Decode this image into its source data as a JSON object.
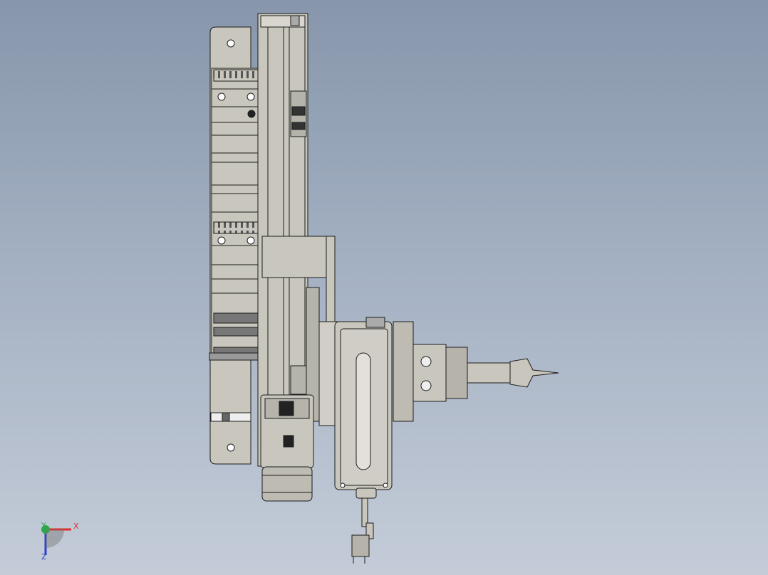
{
  "viewport": {
    "background_top": "#8796ab",
    "background_bottom": "#c4ccd8",
    "part_fill": "#c9c7bd",
    "part_stroke": "#1c1c1c"
  },
  "triad": {
    "x_label": "X",
    "y_label": "Y",
    "z_label": "Z",
    "x_color": "#d9302c",
    "y_color": "#2aa84a",
    "z_color": "#2b3fc9"
  }
}
